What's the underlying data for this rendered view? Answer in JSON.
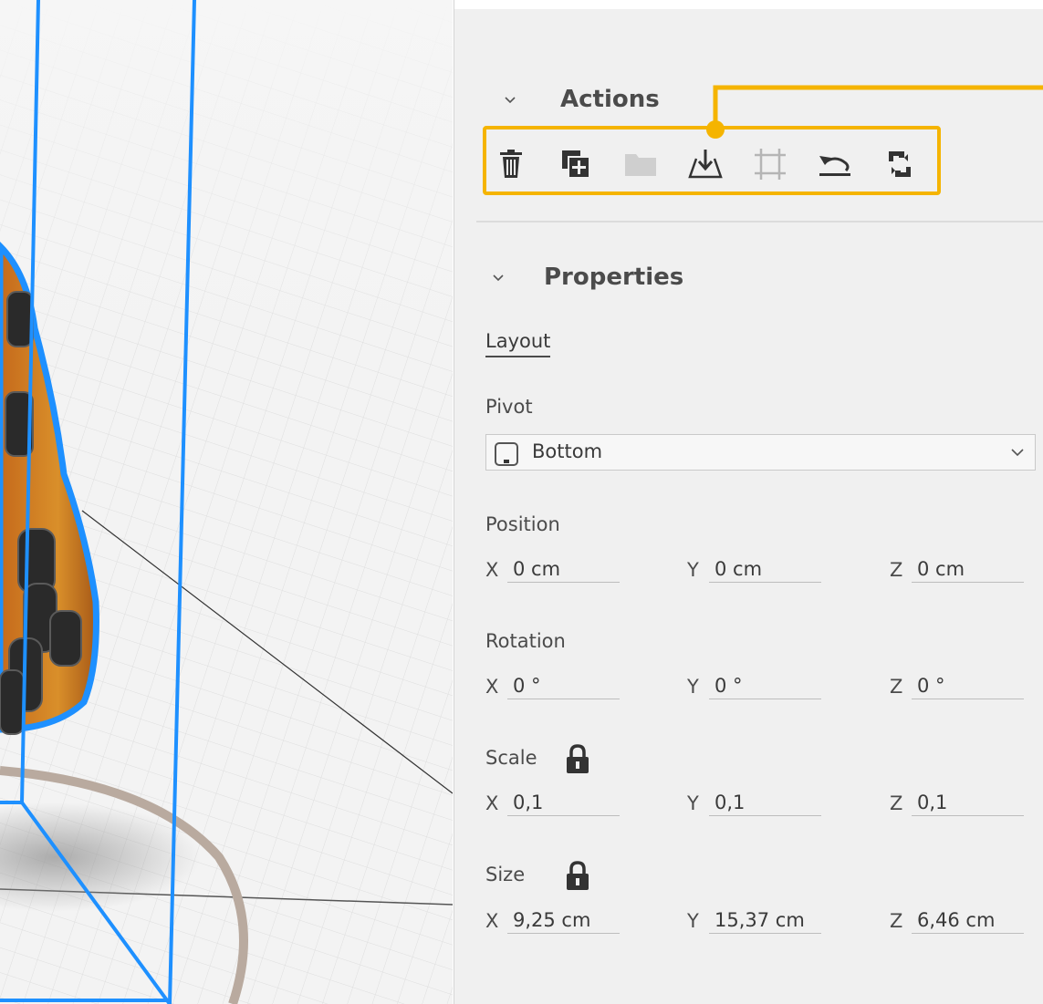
{
  "actions": {
    "title": "Actions",
    "tools": [
      {
        "icon": "trash-icon"
      },
      {
        "icon": "duplicate-icon"
      },
      {
        "icon": "folder-icon"
      },
      {
        "icon": "drop-to-ground-icon"
      },
      {
        "icon": "frame-icon"
      },
      {
        "icon": "undo-icon"
      },
      {
        "icon": "replace-icon"
      }
    ]
  },
  "properties": {
    "title": "Properties",
    "tab_layout": "Layout",
    "pivot": {
      "label": "Pivot",
      "value": "Bottom"
    },
    "position": {
      "label": "Position",
      "x": {
        "axis": "X",
        "value": "0 cm"
      },
      "y": {
        "axis": "Y",
        "value": "0 cm"
      },
      "z": {
        "axis": "Z",
        "value": "0 cm"
      }
    },
    "rotation": {
      "label": "Rotation",
      "x": {
        "axis": "X",
        "value": "0 °"
      },
      "y": {
        "axis": "Y",
        "value": "0 °"
      },
      "z": {
        "axis": "Z",
        "value": "0 °"
      }
    },
    "scale": {
      "label": "Scale",
      "x": {
        "axis": "X",
        "value": "0,1"
      },
      "y": {
        "axis": "Y",
        "value": "0,1"
      },
      "z": {
        "axis": "Z",
        "value": "0,1"
      }
    },
    "size": {
      "label": "Size",
      "x": {
        "axis": "X",
        "value": "9,25 cm"
      },
      "y": {
        "axis": "Y",
        "value": "15,37 cm"
      },
      "z": {
        "axis": "Z",
        "value": "6,46 cm"
      }
    }
  },
  "colors": {
    "highlight": "#f5b400",
    "selection": "#1e90ff",
    "panel_background": "#f0f0f0"
  }
}
